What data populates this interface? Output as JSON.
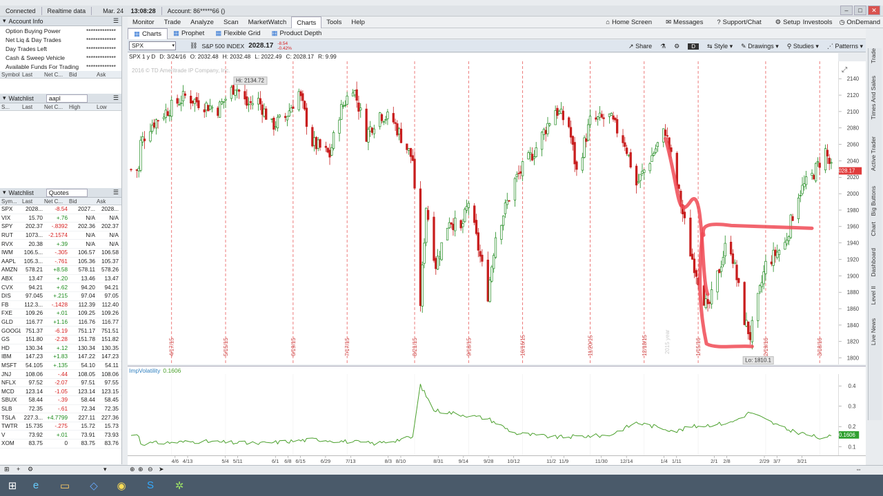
{
  "statusbar": {
    "connected": "Connected",
    "realtime": "Realtime data",
    "datetime": "Mar. 24",
    "time": "13:08:28",
    "account": "Account: 86*****66 ()"
  },
  "topmenu": [
    "Monitor",
    "Trade",
    "Analyze",
    "Scan",
    "MarketWatch",
    "Charts",
    "Tools",
    "Help"
  ],
  "topright": [
    {
      "icon": "home-icon",
      "label": "Home Screen"
    },
    {
      "icon": "mail-icon",
      "label": "Messages"
    },
    {
      "icon": "help-icon",
      "label": "Support/Chat"
    },
    {
      "icon": "gear-icon",
      "label": "Setup"
    }
  ],
  "investools": "Investools",
  "ondemand": "OnDemand",
  "account_info": {
    "title": "Account Info",
    "rows": [
      {
        "label": "Option Buying Power",
        "value": "*************"
      },
      {
        "label": "Net Liq & Day Trades",
        "value": "*************"
      },
      {
        "label": "Day Trades Left",
        "value": "*************"
      },
      {
        "label": "Cash & Sweep Vehicle",
        "value": "*************"
      },
      {
        "label": "Available Funds For Trading",
        "value": "*************"
      }
    ],
    "columns": [
      "Symbol",
      "Last",
      "Net C...",
      "Bid",
      "Ask"
    ]
  },
  "watchlist1": {
    "title": "Watchlist",
    "name": "aapl",
    "columns": [
      "S...",
      "Last",
      "Net C...",
      "High",
      "Low"
    ]
  },
  "watchlist2": {
    "title": "Watchlist",
    "name": "Quotes",
    "columns": [
      "Sym...",
      "Last",
      "Net C...",
      "Bid",
      "Ask"
    ],
    "rows": [
      [
        "SPX",
        "2028...",
        "-8.54",
        "2027...",
        "2028..."
      ],
      [
        "VIX",
        "15.70",
        "+.76",
        "N/A",
        "N/A"
      ],
      [
        "SPY",
        "202.37",
        "-.8392",
        "202.36",
        "202.37"
      ],
      [
        "RUT",
        "1073...",
        "-2.1574",
        "N/A",
        "N/A"
      ],
      [
        "RVX",
        "20.38",
        "+.39",
        "N/A",
        "N/A"
      ],
      [
        "IWM",
        "106.5...",
        "-.305",
        "106.57",
        "106.58"
      ],
      [
        "AAPL",
        "105.3...",
        "-.761",
        "105.36",
        "105.37"
      ],
      [
        "AMZN",
        "578.21",
        "+8.58",
        "578.11",
        "578.26"
      ],
      [
        "ABX",
        "13.47",
        "+.20",
        "13.46",
        "13.47"
      ],
      [
        "CVX",
        "94.21",
        "+.62",
        "94.20",
        "94.21"
      ],
      [
        "DIS",
        "97.045",
        "+.215",
        "97.04",
        "97.05"
      ],
      [
        "FB",
        "112.3...",
        "-.1428",
        "112.39",
        "112.40"
      ],
      [
        "FXE",
        "109.26",
        "+.01",
        "109.25",
        "109.26"
      ],
      [
        "GLD",
        "116.77",
        "+1.16",
        "116.76",
        "116.77"
      ],
      [
        "GOOGL",
        "751.37",
        "-6.19",
        "751.17",
        "751.51"
      ],
      [
        "GS",
        "151.80",
        "-2.28",
        "151.78",
        "151.82"
      ],
      [
        "HD",
        "130.34",
        "+.12",
        "130.34",
        "130.35"
      ],
      [
        "IBM",
        "147.23",
        "+1.83",
        "147.22",
        "147.23"
      ],
      [
        "MSFT",
        "54.105",
        "+.135",
        "54.10",
        "54.11"
      ],
      [
        "JNJ",
        "108.06",
        "-.44",
        "108.05",
        "108.06"
      ],
      [
        "NFLX",
        "97.52",
        "-2.07",
        "97.51",
        "97.55"
      ],
      [
        "MCD",
        "123.14",
        "-1.05",
        "123.14",
        "123.15"
      ],
      [
        "SBUX",
        "58.44",
        "-.39",
        "58.44",
        "58.45"
      ],
      [
        "SLB",
        "72.35",
        "-.61",
        "72.34",
        "72.35"
      ],
      [
        "TSLA",
        "227.3...",
        "+4.7799",
        "227.11",
        "227.36"
      ],
      [
        "TWTR",
        "15.735",
        "-.275",
        "15.72",
        "15.73"
      ],
      [
        "V",
        "73.92",
        "+.01",
        "73.91",
        "73.93"
      ],
      [
        "XOM",
        "83.75",
        "0",
        "83.75",
        "83.76"
      ]
    ]
  },
  "chart_tabs": [
    {
      "icon": "chart-icon",
      "label": "Charts"
    },
    {
      "icon": "prophet-icon",
      "label": "Prophet"
    },
    {
      "icon": "grid-icon",
      "label": "Flexible Grid"
    },
    {
      "icon": "depth-icon",
      "label": "Product Depth"
    }
  ],
  "toolbar": {
    "symbol": "SPX",
    "description": "S&P 500 INDEX",
    "last": "2028.17",
    "change": "-8.54",
    "change_pct": "-0.42%",
    "share": "Share",
    "dchip": "D",
    "style": "Style",
    "drawings": "Drawings",
    "studies": "Studies",
    "patterns": "Patterns"
  },
  "infobar": {
    "period": "SPX 1 y D",
    "date": "D: 3/24/16",
    "open": "O: 2032.48",
    "high": "H: 2032.48",
    "low": "L: 2022.49",
    "close": "C: 2028.17",
    "range": "R: 9.99"
  },
  "copyright": "2016 © TD Ameritrade IP Company, Inc.",
  "hi_label": "Hi: 2134.72",
  "lo_label": "Lo: 1810.1",
  "year_label": "2015 year",
  "price_tag": "2028.17",
  "study": {
    "name": "ImpVolatility",
    "value": "0.1606"
  },
  "colors": {
    "up": "#1e8a1e",
    "down": "#c81e1e",
    "annotation": "#f04a55",
    "iv": "#4aa02c",
    "price_tag": "#e03c3c",
    "iv_tag": "#2fa02f"
  },
  "side_tabs": [
    "Trade",
    "Times And Sales",
    "Active Trader",
    "Big Buttons",
    "Chart",
    "Dashboard",
    "Level II",
    "Live News"
  ],
  "chart_data": {
    "type": "candlestick",
    "y_range": [
      1800,
      2150
    ],
    "yticks": [
      1800,
      1820,
      1840,
      1860,
      1880,
      1900,
      1920,
      1940,
      1960,
      1980,
      2000,
      2020,
      2040,
      2060,
      2080,
      2100,
      2120,
      2140
    ],
    "event_markers": [
      "4/17/15",
      "5/15/15",
      "6/19/15",
      "7/17/15",
      "8/21/15",
      "9/18/15",
      "10/16/15",
      "11/20/15",
      "12/18/15",
      "1/15/16",
      "2/19/16",
      "3/18/16"
    ],
    "xticks": [
      "4/6",
      "4/13",
      "5/4",
      "5/11",
      "6/1",
      "6/8",
      "6/15",
      "6/29",
      "7/13",
      "8/3",
      "8/10",
      "8/31",
      "9/14",
      "9/28",
      "10/12",
      "11/2",
      "11/9",
      "11/30",
      "12/14",
      "1/4",
      "1/11",
      "2/1",
      "2/8",
      "2/29",
      "3/7",
      "3/21"
    ],
    "close_path": [
      [
        "4/1/15",
        2060
      ],
      [
        "4/6/15",
        2080
      ],
      [
        "4/13/15",
        2095
      ],
      [
        "4/24/15",
        2115
      ],
      [
        "5/4/15",
        2105
      ],
      [
        "5/11/15",
        2100
      ],
      [
        "5/20/15",
        2128
      ],
      [
        "5/26/15",
        2105
      ],
      [
        "6/1/15",
        2110
      ],
      [
        "6/8/15",
        2080
      ],
      [
        "6/15/15",
        2090
      ],
      [
        "6/22/15",
        2120
      ],
      [
        "6/29/15",
        2060
      ],
      [
        "7/8/15",
        2045
      ],
      [
        "7/13/15",
        2095
      ],
      [
        "7/20/15",
        2128
      ],
      [
        "7/27/15",
        2070
      ],
      [
        "8/3/15",
        2095
      ],
      [
        "8/10/15",
        2085
      ],
      [
        "8/20/15",
        2040
      ],
      [
        "8/24/15",
        1870
      ],
      [
        "8/27/15",
        1985
      ],
      [
        "9/1/15",
        1915
      ],
      [
        "9/8/15",
        1970
      ],
      [
        "9/14/15",
        1955
      ],
      [
        "9/18/15",
        1990
      ],
      [
        "9/28/15",
        1880
      ],
      [
        "10/2/15",
        1950
      ],
      [
        "10/12/15",
        2015
      ],
      [
        "10/22/15",
        2050
      ],
      [
        "11/2/15",
        2100
      ],
      [
        "11/9/15",
        2080
      ],
      [
        "11/13/15",
        2025
      ],
      [
        "11/20/15",
        2085
      ],
      [
        "11/30/15",
        2090
      ],
      [
        "12/8/15",
        2060
      ],
      [
        "12/14/15",
        2010
      ],
      [
        "12/21/15",
        2040
      ],
      [
        "12/29/15",
        2075
      ],
      [
        "1/4/16",
        2010
      ],
      [
        "1/11/16",
        1930
      ],
      [
        "1/20/16",
        1860
      ],
      [
        "1/29/16",
        1935
      ],
      [
        "2/1/16",
        1935
      ],
      [
        "2/8/16",
        1850
      ],
      [
        "2/11/16",
        1830
      ],
      [
        "2/19/16",
        1915
      ],
      [
        "2/29/16",
        1940
      ],
      [
        "3/7/16",
        2000
      ],
      [
        "3/14/16",
        2020
      ],
      [
        "3/21/16",
        2050
      ],
      [
        "3/24/16",
        2028
      ]
    ],
    "annotations": [
      {
        "kind": "decline",
        "points": [
          [
            "12/29/15",
            2065
          ],
          [
            "1/11/16",
            1990
          ],
          [
            "1/20/16",
            1880
          ]
        ]
      },
      {
        "kind": "box",
        "points": [
          [
            "1/20/16",
            1960
          ],
          [
            "3/14/16",
            1960
          ]
        ]
      },
      {
        "kind": "box",
        "points": [
          [
            "1/20/16",
            1840
          ],
          [
            "2/12/16",
            1818
          ]
        ]
      }
    ],
    "iv_path": [
      [
        "4/1/15",
        0.12
      ],
      [
        "5/1/15",
        0.13
      ],
      [
        "6/1/15",
        0.12
      ],
      [
        "7/1/15",
        0.14
      ],
      [
        "8/1/15",
        0.12
      ],
      [
        "8/20/15",
        0.15
      ],
      [
        "8/24/15",
        0.4
      ],
      [
        "8/31/15",
        0.28
      ],
      [
        "9/14/15",
        0.26
      ],
      [
        "9/28/15",
        0.24
      ],
      [
        "10/12/15",
        0.17
      ],
      [
        "11/2/15",
        0.15
      ],
      [
        "11/30/15",
        0.16
      ],
      [
        "12/14/15",
        0.22
      ],
      [
        "1/4/16",
        0.18
      ],
      [
        "1/11/16",
        0.2
      ],
      [
        "2/1/16",
        0.22
      ],
      [
        "2/11/16",
        0.27
      ],
      [
        "2/29/16",
        0.19
      ],
      [
        "3/21/16",
        0.14
      ],
      [
        "3/24/16",
        0.16
      ]
    ],
    "iv_ticks": [
      0.1,
      0.2,
      0.3,
      0.4
    ]
  }
}
